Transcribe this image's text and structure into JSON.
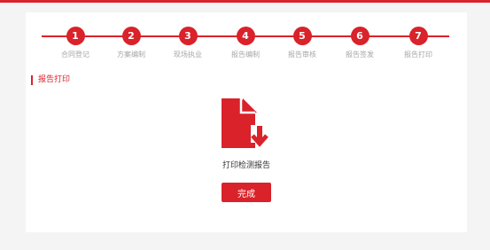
{
  "steps": [
    {
      "number": "1",
      "label": "合同登记"
    },
    {
      "number": "2",
      "label": "方案编制"
    },
    {
      "number": "3",
      "label": "现场执业"
    },
    {
      "number": "4",
      "label": "报告编制"
    },
    {
      "number": "5",
      "label": "报告审核"
    },
    {
      "number": "6",
      "label": "报告签发"
    },
    {
      "number": "7",
      "label": "报告打印"
    }
  ],
  "section": {
    "title": "报告打印"
  },
  "document": {
    "label": "打印检测报告",
    "icon": "document-download-icon"
  },
  "actions": {
    "done_label": "完成"
  },
  "colors": {
    "accent": "#d9222a",
    "muted_text": "#a6a6a6",
    "background": "#f4f4f4"
  }
}
